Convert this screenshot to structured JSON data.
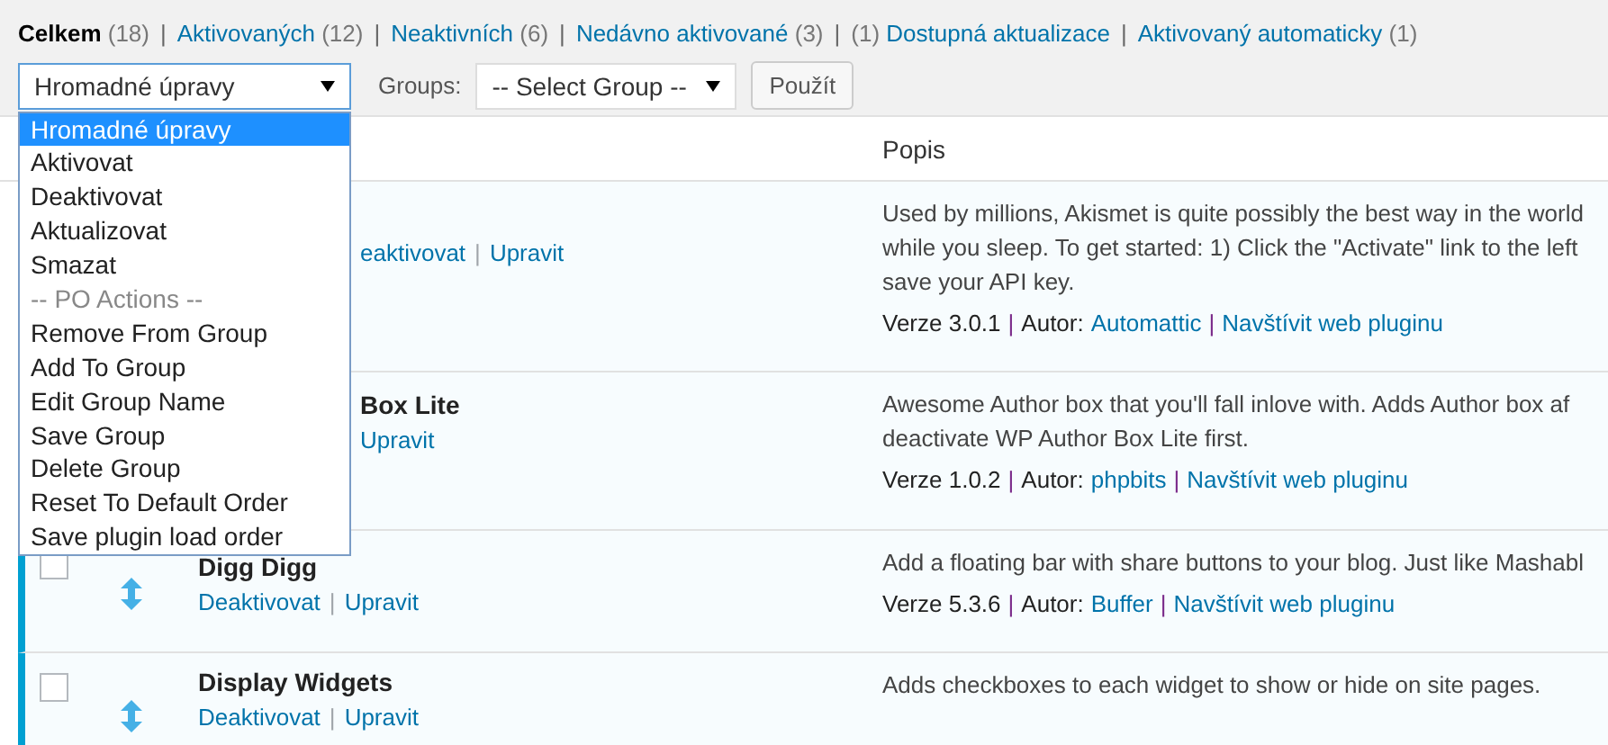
{
  "filters": [
    {
      "label": "Celkem",
      "count": "(18)",
      "kind": "count_after",
      "selected": true
    },
    {
      "separator": "|",
      "label": "Aktivovaných",
      "count": "(12)",
      "kind": "count_after",
      "selected": false
    },
    {
      "separator": "|",
      "label": "Neaktivních",
      "count": "(6)",
      "kind": "count_after",
      "selected": false
    },
    {
      "separator": "|",
      "label": "Nedávno aktivované",
      "count": "(3)",
      "kind": "count_after",
      "selected": false
    },
    {
      "separator": "|",
      "label": "Dostupná aktualizace",
      "count": "(1)",
      "kind": "count_before",
      "selected": false
    },
    {
      "separator": "|",
      "label": "Aktivovaný automaticky",
      "count": "(1)",
      "kind": "count_after",
      "selected": false
    }
  ],
  "bulk_select": {
    "value": "Hromadné úpravy",
    "expanded": true,
    "options": [
      {
        "label": "Hromadné úpravy",
        "kind": "option",
        "selected": true
      },
      {
        "label": "Aktivovat",
        "kind": "option",
        "selected": false
      },
      {
        "label": "Deaktivovat",
        "kind": "option",
        "selected": false
      },
      {
        "label": "Aktualizovat",
        "kind": "option",
        "selected": false
      },
      {
        "label": "Smazat",
        "kind": "option",
        "selected": false
      },
      {
        "label": "-- PO Actions --",
        "kind": "group_header",
        "selected": false
      },
      {
        "label": "Remove From Group",
        "kind": "option",
        "selected": false
      },
      {
        "label": "Add To Group",
        "kind": "option",
        "selected": false
      },
      {
        "label": "Edit Group Name",
        "kind": "option",
        "selected": false
      },
      {
        "label": "Save Group",
        "kind": "option",
        "selected": false
      },
      {
        "label": "Delete Group",
        "kind": "option",
        "selected": false
      },
      {
        "label": "Reset To Default Order",
        "kind": "option",
        "selected": false
      },
      {
        "label": "Save plugin load order",
        "kind": "option",
        "selected": false
      }
    ]
  },
  "groups": {
    "label": "Groups:",
    "value": "-- Select Group --"
  },
  "apply_button": "Použít",
  "table": {
    "columns": [
      {
        "label": "Popis"
      }
    ],
    "rows": [
      {
        "clipped": true,
        "active": true,
        "name": "",
        "actions": [
          {
            "text": "eaktivovat",
            "kind": "link"
          },
          {
            "text": "|",
            "kind": "separator"
          },
          {
            "text": "Upravit",
            "kind": "link"
          }
        ],
        "description": [
          "Used by millions, Akismet is quite possibly the best way in the world",
          "while you sleep. To get started: 1) Click the \"Activate\" link to the left",
          "save your API key."
        ],
        "meta": [
          {
            "text": "Verze 3.0.1",
            "kind": "text"
          },
          {
            "text": "|",
            "kind": "separator"
          },
          {
            "text": "Autor:",
            "kind": "text"
          },
          {
            "text": "Automattic",
            "kind": "link"
          },
          {
            "text": "|",
            "kind": "separator"
          },
          {
            "text": "Navštívit web pluginu",
            "kind": "link"
          }
        ]
      },
      {
        "clipped": true,
        "active": true,
        "name": "Box Lite",
        "actions": [
          {
            "text": "Upravit",
            "kind": "link"
          }
        ],
        "description": [
          "Awesome Author box that you'll fall inlove with. Adds Author box af",
          "deactivate WP Author Box Lite first."
        ],
        "meta": [
          {
            "text": "Verze 1.0.2",
            "kind": "text"
          },
          {
            "text": "|",
            "kind": "separator"
          },
          {
            "text": "Autor:",
            "kind": "text"
          },
          {
            "text": "phpbits",
            "kind": "link"
          },
          {
            "text": "|",
            "kind": "separator"
          },
          {
            "text": "Navštívit web pluginu",
            "kind": "link"
          }
        ]
      },
      {
        "clipped": false,
        "active": true,
        "checked": false,
        "name": "Digg Digg",
        "actions": [
          {
            "text": "Deaktivovat",
            "kind": "link"
          },
          {
            "text": "|",
            "kind": "separator"
          },
          {
            "text": "Upravit",
            "kind": "link"
          }
        ],
        "description": [
          "Add a floating bar with share buttons to your blog. Just like Mashabl"
        ],
        "meta": [
          {
            "text": "Verze 5.3.6",
            "kind": "text"
          },
          {
            "text": "|",
            "kind": "separator"
          },
          {
            "text": "Autor:",
            "kind": "text"
          },
          {
            "text": "Buffer",
            "kind": "link"
          },
          {
            "text": "|",
            "kind": "separator"
          },
          {
            "text": "Navštívit web pluginu",
            "kind": "link"
          }
        ]
      },
      {
        "clipped": false,
        "active": true,
        "checked": false,
        "name": "Display Widgets",
        "actions": [
          {
            "text": "Deaktivovat",
            "kind": "link"
          },
          {
            "text": "|",
            "kind": "separator"
          },
          {
            "text": "Upravit",
            "kind": "link"
          }
        ],
        "description": [
          "Adds checkboxes to each widget to show or hide on site pages."
        ]
      }
    ]
  }
}
